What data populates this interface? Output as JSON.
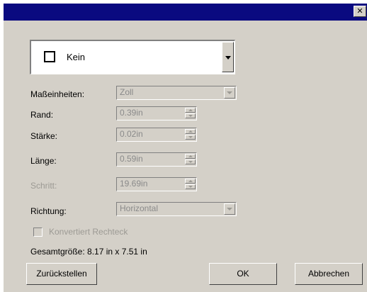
{
  "window": {
    "close_glyph": "✕",
    "title_bar_color": "#0a0a80"
  },
  "style_combo": {
    "value": "Kein"
  },
  "rows": {
    "units": {
      "label": "Maßeinheiten:",
      "value": "Zoll"
    },
    "margin": {
      "label": "Rand:",
      "value": "0.39in"
    },
    "thickness": {
      "label": "Stärke:",
      "value": "0.02in"
    },
    "length": {
      "label": "Länge:",
      "value": "0.59in"
    },
    "step": {
      "label": "Schritt:",
      "value": "19.69in"
    },
    "direction": {
      "label": "Richtung:",
      "value": "Horizontal"
    }
  },
  "convert_checkbox": {
    "label": "Konvertiert Rechteck",
    "checked": false
  },
  "total_size": "Gesamtgröße: 8.17 in x 7.51 in",
  "buttons": {
    "reset": "Zurückstellen",
    "ok": "OK",
    "cancel": "Abbrechen"
  }
}
